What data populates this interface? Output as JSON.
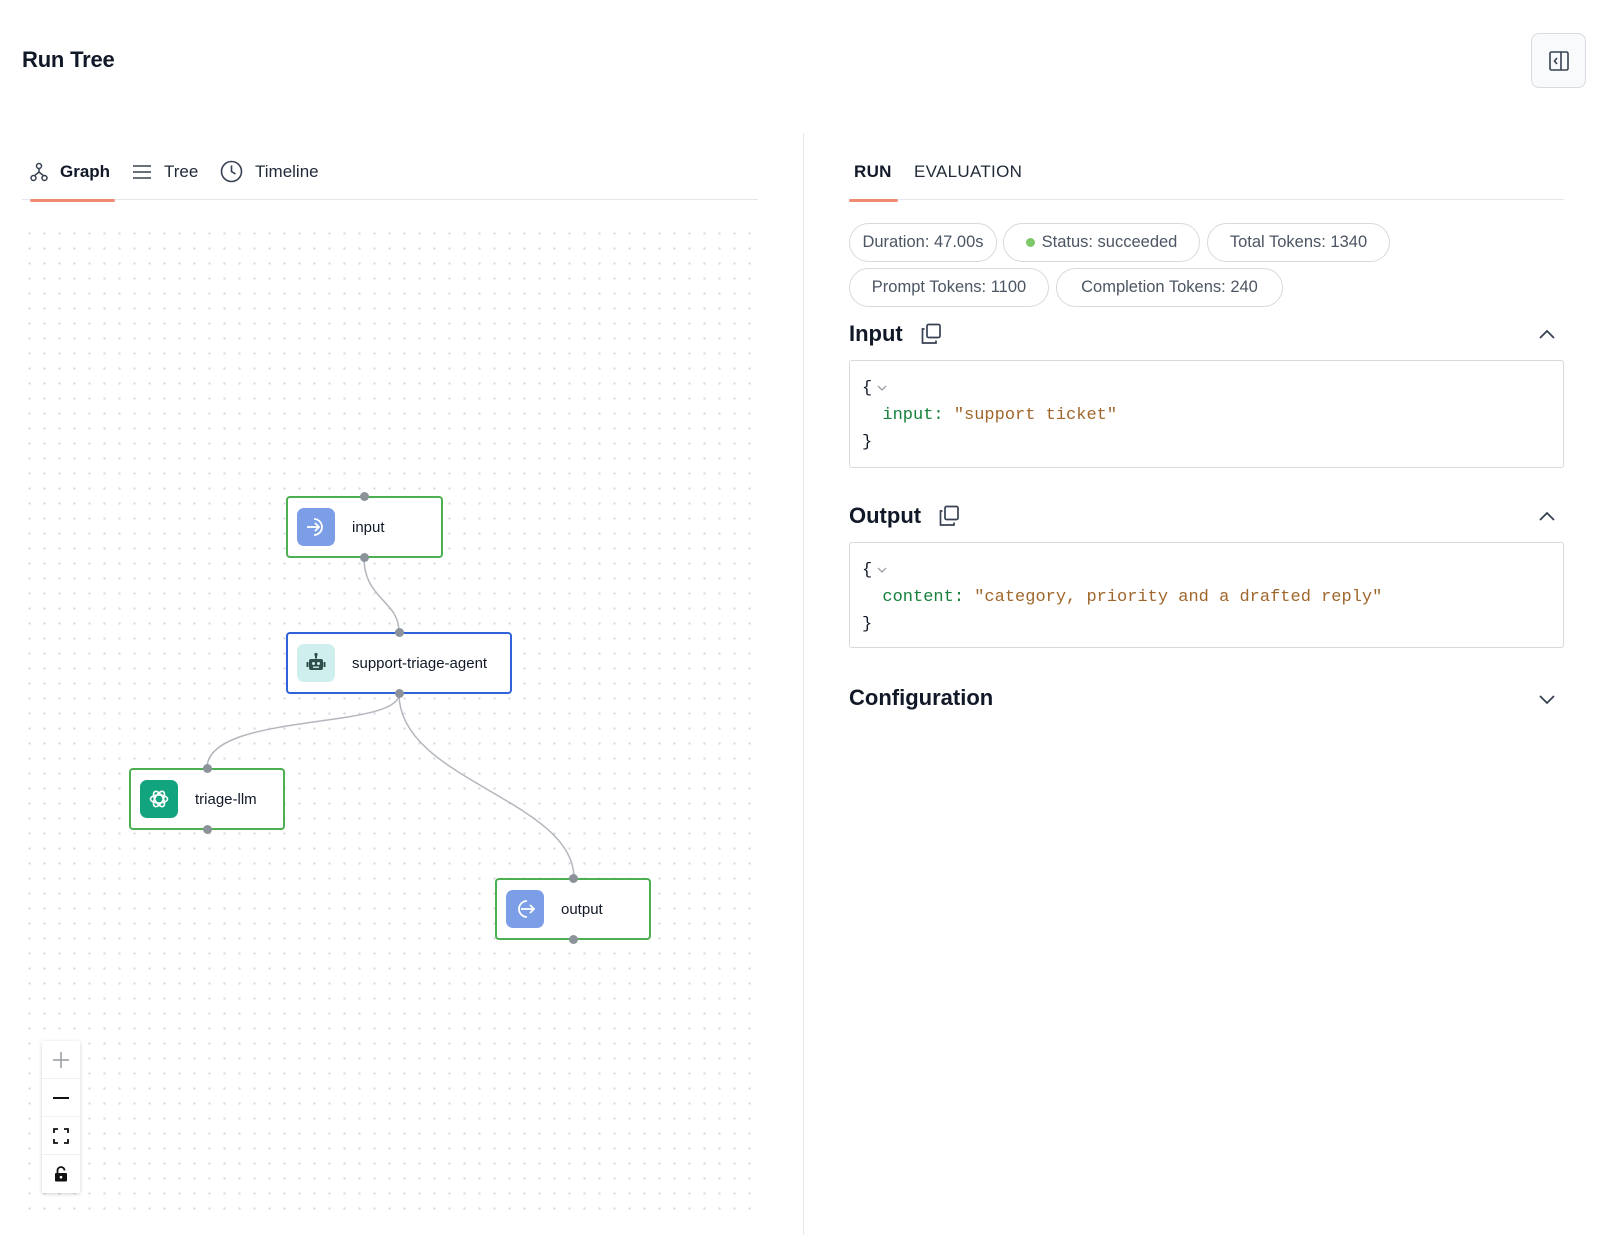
{
  "header": {
    "title": "Run Tree"
  },
  "left_tabs": [
    {
      "label": "Graph",
      "icon": "graph-icon",
      "active": true
    },
    {
      "label": "Tree",
      "icon": "list-icon",
      "active": false
    },
    {
      "label": "Timeline",
      "icon": "clock-icon",
      "active": false
    }
  ],
  "graph": {
    "nodes": [
      {
        "label": "input",
        "type": "input",
        "icon": "arrow-in-icon"
      },
      {
        "label": "support-triage-agent",
        "type": "agent",
        "icon": "robot-icon"
      },
      {
        "label": "triage-llm",
        "type": "llm",
        "icon": "openai-icon"
      },
      {
        "label": "output",
        "type": "output",
        "icon": "arrow-out-icon"
      }
    ],
    "edges": [
      {
        "from": "input",
        "to": "support-triage-agent"
      },
      {
        "from": "support-triage-agent",
        "to": "triage-llm"
      },
      {
        "from": "support-triage-agent",
        "to": "output"
      }
    ]
  },
  "zoom_controls": [
    "zoom-in-icon",
    "zoom-out-icon",
    "fit-view-icon",
    "lock-icon"
  ],
  "right_tabs": [
    {
      "label": "RUN",
      "active": true
    },
    {
      "label": "EVALUATION",
      "active": false
    }
  ],
  "badges": {
    "duration": "Duration: 47.00s",
    "status": "Status: succeeded",
    "total_tokens": "Total Tokens: 1340",
    "prompt_tokens": "Prompt Tokens: 1100",
    "completion_tokens": "Completion Tokens: 240"
  },
  "sections": {
    "input": {
      "title": "Input",
      "open_brace": "{",
      "key": "input:",
      "value": "\"support ticket\"",
      "close_brace": "}"
    },
    "output": {
      "title": "Output",
      "open_brace": "{",
      "key": "content:",
      "value": "\"category, priority and a drafted reply\"",
      "close_brace": "}"
    },
    "configuration": {
      "title": "Configuration"
    }
  },
  "colors": {
    "accent": "#f08a74",
    "node_border": "#4caf50",
    "agent_border": "#2f63d8",
    "status_dot": "#7dc868",
    "json_key": "#16803c",
    "json_string": "#a0662b"
  }
}
